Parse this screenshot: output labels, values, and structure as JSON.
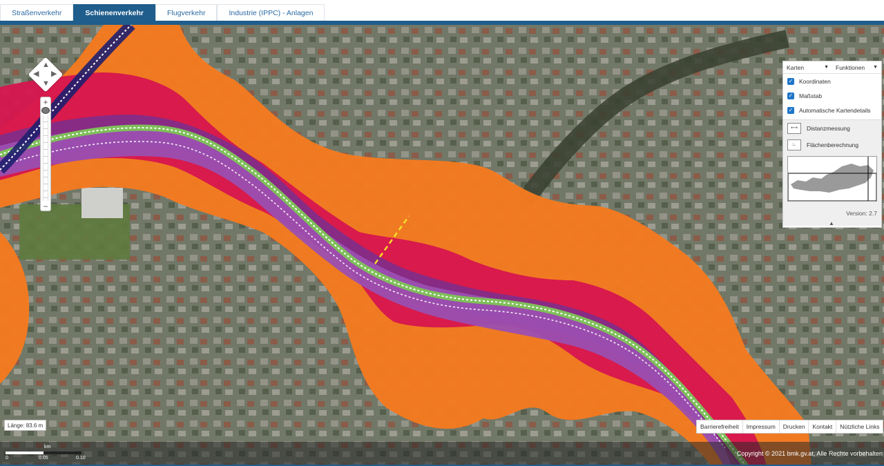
{
  "tabs": [
    {
      "label": "Straßenverkehr",
      "active": false
    },
    {
      "label": "Schienenverkehr",
      "active": true
    },
    {
      "label": "Flugverkehr",
      "active": false
    },
    {
      "label": "Industrie (IPPC) - Anlagen",
      "active": false
    }
  ],
  "panel": {
    "maps_label": "Karten",
    "functions_label": "Funktionen",
    "checkboxes": [
      {
        "label": "Koordinaten",
        "checked": true
      },
      {
        "label": "Maßstab",
        "checked": true
      },
      {
        "label": "Automatische Kartendetails",
        "checked": true
      }
    ],
    "tools": [
      {
        "label": "Distanzmessung"
      },
      {
        "label": "Flächenberechnung"
      }
    ],
    "version": "Version: 2.7"
  },
  "measurement": {
    "length_text": "Länge: 83.6 m"
  },
  "footer_links": [
    "Barrierefreiheit",
    "Impressum",
    "Drucken",
    "Kontakt",
    "Nützliche Links"
  ],
  "copyright": "Copyright © 2021 bmk.gv.at, Alle Rechte vorbehalten",
  "scale_bar": {
    "unit": "km",
    "ticks": [
      "0",
      "0.05",
      "0.10"
    ]
  },
  "colors": {
    "accent": "#1f5d8c",
    "noise_orange": "#f47a20",
    "noise_red": "#d6154f",
    "noise_purple": "#7a2f8e",
    "noise_violet": "#9b4fb0",
    "railway_green": "#7fbf5a",
    "measure_line": "#f5e02a"
  }
}
